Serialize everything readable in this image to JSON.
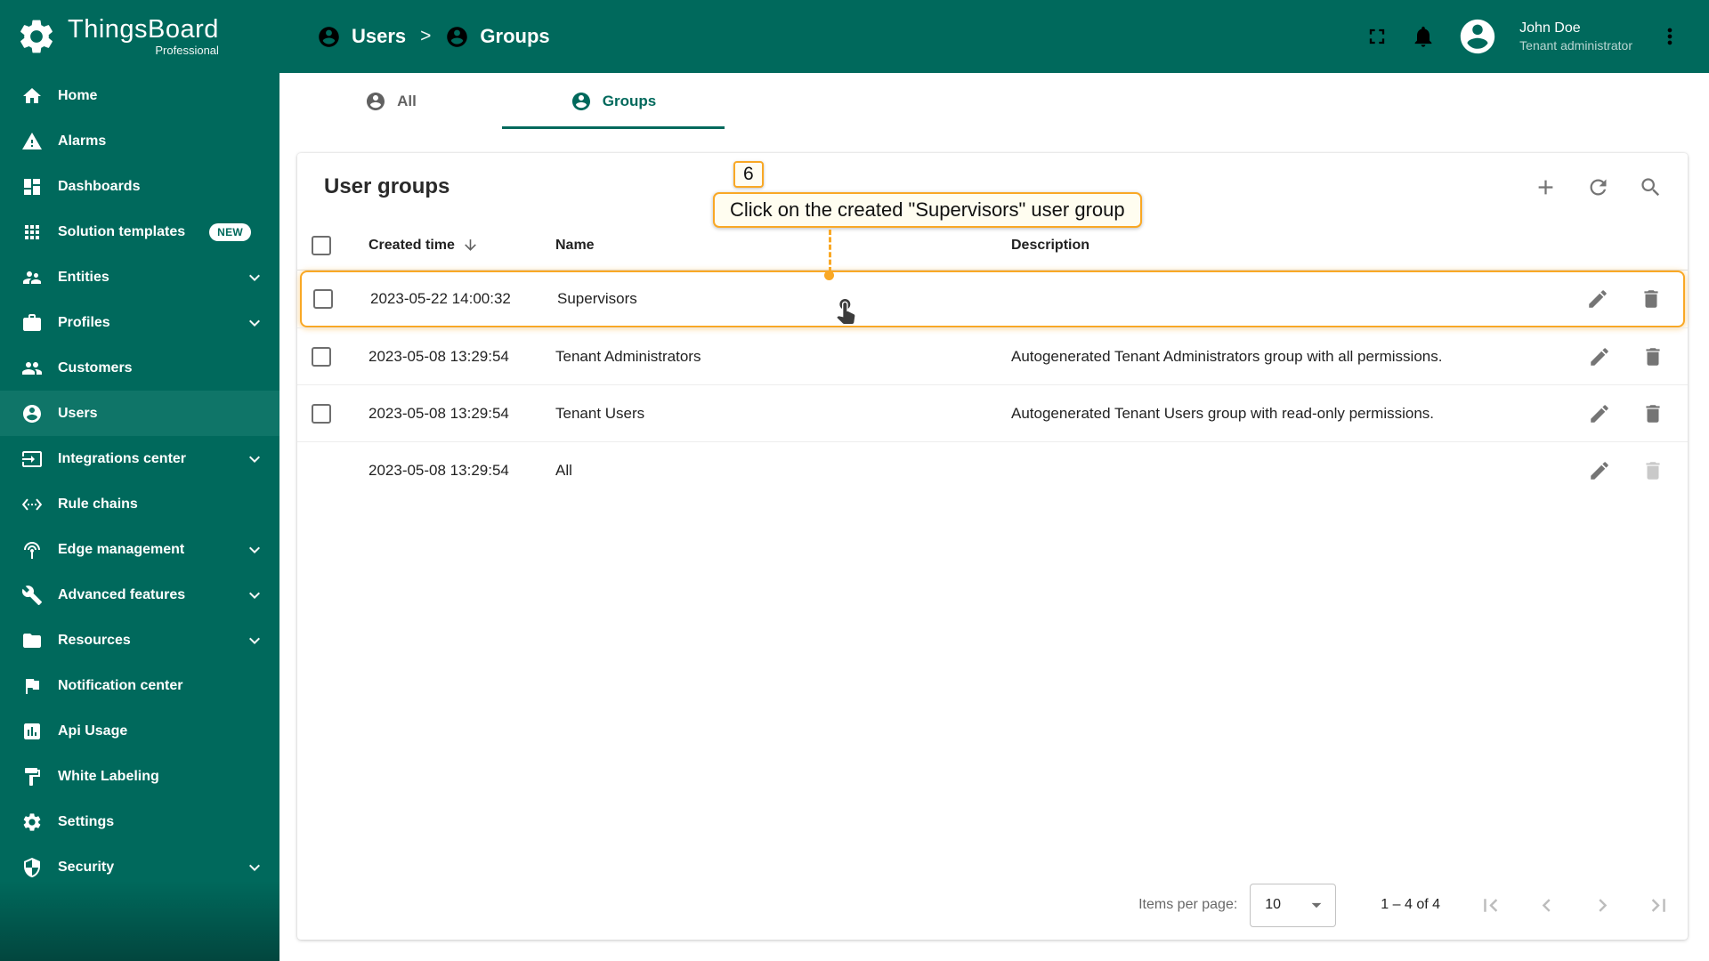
{
  "app": {
    "logo_title": "ThingsBoard",
    "logo_subtitle": "Professional"
  },
  "header": {
    "breadcrumb_users": "Users",
    "breadcrumb_separator": ">",
    "breadcrumb_groups": "Groups",
    "user_name": "John Doe",
    "user_role": "Tenant administrator"
  },
  "sidebar": {
    "items": [
      {
        "label": "Home",
        "icon": "home-icon"
      },
      {
        "label": "Alarms",
        "icon": "alarms-icon"
      },
      {
        "label": "Dashboards",
        "icon": "dashboards-icon"
      },
      {
        "label": "Solution templates",
        "icon": "solution-templates-icon",
        "badge": "NEW"
      },
      {
        "label": "Entities",
        "icon": "entities-icon",
        "expandable": true
      },
      {
        "label": "Profiles",
        "icon": "profiles-icon",
        "expandable": true
      },
      {
        "label": "Customers",
        "icon": "customers-icon"
      },
      {
        "label": "Users",
        "icon": "users-icon",
        "active": true
      },
      {
        "label": "Integrations center",
        "icon": "integrations-center-icon",
        "expandable": true
      },
      {
        "label": "Rule chains",
        "icon": "rule-chains-icon"
      },
      {
        "label": "Edge management",
        "icon": "edge-management-icon",
        "expandable": true
      },
      {
        "label": "Advanced features",
        "icon": "advanced-features-icon",
        "expandable": true
      },
      {
        "label": "Resources",
        "icon": "resources-icon",
        "expandable": true
      },
      {
        "label": "Notification center",
        "icon": "notification-center-icon"
      },
      {
        "label": "Api Usage",
        "icon": "api-usage-icon"
      },
      {
        "label": "White Labeling",
        "icon": "white-labeling-icon"
      },
      {
        "label": "Settings",
        "icon": "settings-icon"
      },
      {
        "label": "Security",
        "icon": "security-icon",
        "expandable": true
      }
    ]
  },
  "tabs": {
    "all": "All",
    "groups": "Groups"
  },
  "table": {
    "title": "User groups",
    "columns": {
      "created_time": "Created time",
      "name": "Name",
      "description": "Description"
    },
    "rows": [
      {
        "created_time": "2023-05-22 14:00:32",
        "name": "Supervisors",
        "description": "",
        "highlighted": true,
        "has_checkbox": true
      },
      {
        "created_time": "2023-05-08 13:29:54",
        "name": "Tenant Administrators",
        "description": "Autogenerated Tenant Administrators group with all permissions.",
        "highlighted": false,
        "has_checkbox": true
      },
      {
        "created_time": "2023-05-08 13:29:54",
        "name": "Tenant Users",
        "description": "Autogenerated Tenant Users group with read-only permissions.",
        "highlighted": false,
        "has_checkbox": true
      },
      {
        "created_time": "2023-05-08 13:29:54",
        "name": "All",
        "description": "",
        "highlighted": false,
        "has_checkbox": false,
        "delete_disabled": true
      }
    ]
  },
  "pagination": {
    "items_per_page_label": "Items per page:",
    "items_per_page_value": "10",
    "range": "1 – 4 of 4"
  },
  "annotation": {
    "step": "6",
    "text": "Click on the created \"Supervisors\" user group"
  },
  "colors": {
    "primary": "#00695c",
    "accent": "#f9a825"
  }
}
